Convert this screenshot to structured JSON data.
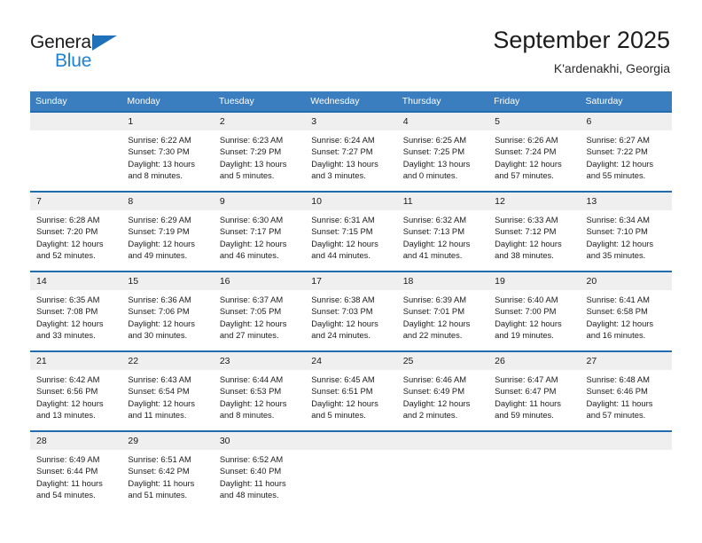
{
  "brand": {
    "name_top": "General",
    "name_bottom": "Blue",
    "triangle_color": "#1e71b8",
    "blue_text_color": "#1e82d4"
  },
  "header": {
    "title": "September 2025",
    "subtitle": "K'ardenakhi, Georgia"
  },
  "theme": {
    "header_bg": "#3a7ebf",
    "row_separator": "#1f6cb0",
    "daynum_bg": "#efefef",
    "text": "#1a1a1a"
  },
  "columns": [
    "Sunday",
    "Monday",
    "Tuesday",
    "Wednesday",
    "Thursday",
    "Friday",
    "Saturday"
  ],
  "weeks": [
    [
      {
        "day": "",
        "empty": true,
        "sunrise": "",
        "sunset": "",
        "daylight_1": "",
        "daylight_2": ""
      },
      {
        "day": "1",
        "empty": false,
        "sunrise": "Sunrise: 6:22 AM",
        "sunset": "Sunset: 7:30 PM",
        "daylight_1": "Daylight: 13 hours",
        "daylight_2": "and 8 minutes."
      },
      {
        "day": "2",
        "empty": false,
        "sunrise": "Sunrise: 6:23 AM",
        "sunset": "Sunset: 7:29 PM",
        "daylight_1": "Daylight: 13 hours",
        "daylight_2": "and 5 minutes."
      },
      {
        "day": "3",
        "empty": false,
        "sunrise": "Sunrise: 6:24 AM",
        "sunset": "Sunset: 7:27 PM",
        "daylight_1": "Daylight: 13 hours",
        "daylight_2": "and 3 minutes."
      },
      {
        "day": "4",
        "empty": false,
        "sunrise": "Sunrise: 6:25 AM",
        "sunset": "Sunset: 7:25 PM",
        "daylight_1": "Daylight: 13 hours",
        "daylight_2": "and 0 minutes."
      },
      {
        "day": "5",
        "empty": false,
        "sunrise": "Sunrise: 6:26 AM",
        "sunset": "Sunset: 7:24 PM",
        "daylight_1": "Daylight: 12 hours",
        "daylight_2": "and 57 minutes."
      },
      {
        "day": "6",
        "empty": false,
        "sunrise": "Sunrise: 6:27 AM",
        "sunset": "Sunset: 7:22 PM",
        "daylight_1": "Daylight: 12 hours",
        "daylight_2": "and 55 minutes."
      }
    ],
    [
      {
        "day": "7",
        "empty": false,
        "sunrise": "Sunrise: 6:28 AM",
        "sunset": "Sunset: 7:20 PM",
        "daylight_1": "Daylight: 12 hours",
        "daylight_2": "and 52 minutes."
      },
      {
        "day": "8",
        "empty": false,
        "sunrise": "Sunrise: 6:29 AM",
        "sunset": "Sunset: 7:19 PM",
        "daylight_1": "Daylight: 12 hours",
        "daylight_2": "and 49 minutes."
      },
      {
        "day": "9",
        "empty": false,
        "sunrise": "Sunrise: 6:30 AM",
        "sunset": "Sunset: 7:17 PM",
        "daylight_1": "Daylight: 12 hours",
        "daylight_2": "and 46 minutes."
      },
      {
        "day": "10",
        "empty": false,
        "sunrise": "Sunrise: 6:31 AM",
        "sunset": "Sunset: 7:15 PM",
        "daylight_1": "Daylight: 12 hours",
        "daylight_2": "and 44 minutes."
      },
      {
        "day": "11",
        "empty": false,
        "sunrise": "Sunrise: 6:32 AM",
        "sunset": "Sunset: 7:13 PM",
        "daylight_1": "Daylight: 12 hours",
        "daylight_2": "and 41 minutes."
      },
      {
        "day": "12",
        "empty": false,
        "sunrise": "Sunrise: 6:33 AM",
        "sunset": "Sunset: 7:12 PM",
        "daylight_1": "Daylight: 12 hours",
        "daylight_2": "and 38 minutes."
      },
      {
        "day": "13",
        "empty": false,
        "sunrise": "Sunrise: 6:34 AM",
        "sunset": "Sunset: 7:10 PM",
        "daylight_1": "Daylight: 12 hours",
        "daylight_2": "and 35 minutes."
      }
    ],
    [
      {
        "day": "14",
        "empty": false,
        "sunrise": "Sunrise: 6:35 AM",
        "sunset": "Sunset: 7:08 PM",
        "daylight_1": "Daylight: 12 hours",
        "daylight_2": "and 33 minutes."
      },
      {
        "day": "15",
        "empty": false,
        "sunrise": "Sunrise: 6:36 AM",
        "sunset": "Sunset: 7:06 PM",
        "daylight_1": "Daylight: 12 hours",
        "daylight_2": "and 30 minutes."
      },
      {
        "day": "16",
        "empty": false,
        "sunrise": "Sunrise: 6:37 AM",
        "sunset": "Sunset: 7:05 PM",
        "daylight_1": "Daylight: 12 hours",
        "daylight_2": "and 27 minutes."
      },
      {
        "day": "17",
        "empty": false,
        "sunrise": "Sunrise: 6:38 AM",
        "sunset": "Sunset: 7:03 PM",
        "daylight_1": "Daylight: 12 hours",
        "daylight_2": "and 24 minutes."
      },
      {
        "day": "18",
        "empty": false,
        "sunrise": "Sunrise: 6:39 AM",
        "sunset": "Sunset: 7:01 PM",
        "daylight_1": "Daylight: 12 hours",
        "daylight_2": "and 22 minutes."
      },
      {
        "day": "19",
        "empty": false,
        "sunrise": "Sunrise: 6:40 AM",
        "sunset": "Sunset: 7:00 PM",
        "daylight_1": "Daylight: 12 hours",
        "daylight_2": "and 19 minutes."
      },
      {
        "day": "20",
        "empty": false,
        "sunrise": "Sunrise: 6:41 AM",
        "sunset": "Sunset: 6:58 PM",
        "daylight_1": "Daylight: 12 hours",
        "daylight_2": "and 16 minutes."
      }
    ],
    [
      {
        "day": "21",
        "empty": false,
        "sunrise": "Sunrise: 6:42 AM",
        "sunset": "Sunset: 6:56 PM",
        "daylight_1": "Daylight: 12 hours",
        "daylight_2": "and 13 minutes."
      },
      {
        "day": "22",
        "empty": false,
        "sunrise": "Sunrise: 6:43 AM",
        "sunset": "Sunset: 6:54 PM",
        "daylight_1": "Daylight: 12 hours",
        "daylight_2": "and 11 minutes."
      },
      {
        "day": "23",
        "empty": false,
        "sunrise": "Sunrise: 6:44 AM",
        "sunset": "Sunset: 6:53 PM",
        "daylight_1": "Daylight: 12 hours",
        "daylight_2": "and 8 minutes."
      },
      {
        "day": "24",
        "empty": false,
        "sunrise": "Sunrise: 6:45 AM",
        "sunset": "Sunset: 6:51 PM",
        "daylight_1": "Daylight: 12 hours",
        "daylight_2": "and 5 minutes."
      },
      {
        "day": "25",
        "empty": false,
        "sunrise": "Sunrise: 6:46 AM",
        "sunset": "Sunset: 6:49 PM",
        "daylight_1": "Daylight: 12 hours",
        "daylight_2": "and 2 minutes."
      },
      {
        "day": "26",
        "empty": false,
        "sunrise": "Sunrise: 6:47 AM",
        "sunset": "Sunset: 6:47 PM",
        "daylight_1": "Daylight: 11 hours",
        "daylight_2": "and 59 minutes."
      },
      {
        "day": "27",
        "empty": false,
        "sunrise": "Sunrise: 6:48 AM",
        "sunset": "Sunset: 6:46 PM",
        "daylight_1": "Daylight: 11 hours",
        "daylight_2": "and 57 minutes."
      }
    ],
    [
      {
        "day": "28",
        "empty": false,
        "sunrise": "Sunrise: 6:49 AM",
        "sunset": "Sunset: 6:44 PM",
        "daylight_1": "Daylight: 11 hours",
        "daylight_2": "and 54 minutes."
      },
      {
        "day": "29",
        "empty": false,
        "sunrise": "Sunrise: 6:51 AM",
        "sunset": "Sunset: 6:42 PM",
        "daylight_1": "Daylight: 11 hours",
        "daylight_2": "and 51 minutes."
      },
      {
        "day": "30",
        "empty": false,
        "sunrise": "Sunrise: 6:52 AM",
        "sunset": "Sunset: 6:40 PM",
        "daylight_1": "Daylight: 11 hours",
        "daylight_2": "and 48 minutes."
      },
      {
        "day": "",
        "empty": true,
        "sunrise": "",
        "sunset": "",
        "daylight_1": "",
        "daylight_2": ""
      },
      {
        "day": "",
        "empty": true,
        "sunrise": "",
        "sunset": "",
        "daylight_1": "",
        "daylight_2": ""
      },
      {
        "day": "",
        "empty": true,
        "sunrise": "",
        "sunset": "",
        "daylight_1": "",
        "daylight_2": ""
      },
      {
        "day": "",
        "empty": true,
        "sunrise": "",
        "sunset": "",
        "daylight_1": "",
        "daylight_2": ""
      }
    ]
  ]
}
